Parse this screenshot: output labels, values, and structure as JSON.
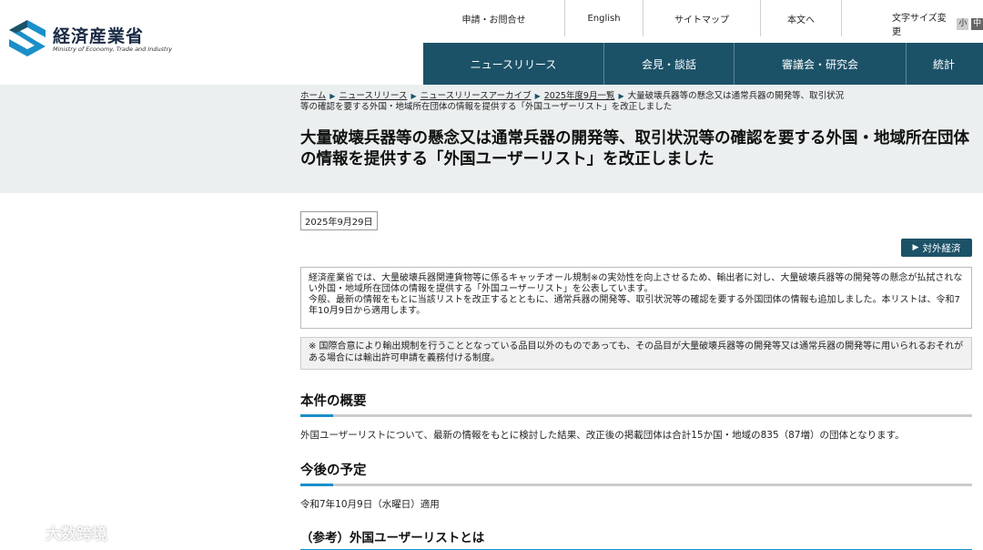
{
  "logo": {
    "name_ja": "経済産業省",
    "name_en": "Ministry of Economy, Trade and Industry"
  },
  "utility_nav": [
    "申請・お問合せ",
    "English",
    "サイトマップ",
    "本文へ"
  ],
  "font_size": {
    "label": "文字サイズ変更",
    "small": "小",
    "medium": "中"
  },
  "main_nav": [
    "ニュースリリース",
    "会見・談話",
    "審議会・研究会",
    "統計"
  ],
  "breadcrumb": {
    "items": [
      "ホーム",
      "ニュースリリース",
      "ニュースリリースアーカイブ",
      "2025年度9月一覧"
    ],
    "current": "大量破壊兵器等の懸念又は通常兵器の開発等、取引状況等の確認を要する外国・地域所在団体の情報を提供する「外国ユーザーリスト」を改正しました"
  },
  "page_title": "大量破壊兵器等の懸念又は通常兵器の開発等、取引状況等の確認を要する外国・地域所在団体の情報を提供する「外国ユーザーリスト」を改正しました",
  "date": "2025年9月29日",
  "tag": "対外経済",
  "lead": {
    "line1": "経済産業省では、大量破壊兵器関連貨物等に係るキャッチオール規制※の実効性を向上させるため、輸出者に対し、大量破壊兵器等の開発等の懸念が払拭されない外国・地域所在団体の情報を提供する「外国ユーザーリスト」を公表しています。",
    "line2": "今般、最新の情報をもとに当該リストを改正するとともに、通常兵器の開発等、取引状況等の確認を要する外国団体の情報も追加しました。本リストは、令和7年10月9日から適用します。"
  },
  "note": "※ 国際合意により輸出規制を行うこととなっている品目以外のものであっても、その品目が大量破壊兵器等の開発等又は通常兵器の開発等に用いられるおそれがある場合には輸出許可申請を義務付ける制度。",
  "sections": [
    {
      "heading": "本件の概要",
      "body": "外国ユーザーリストについて、最新の情報をもとに検討した結果、改正後の掲載団体は合計15か国・地域の835（87増）の団体となります。"
    },
    {
      "heading": "今後の予定",
      "body": "令和7年10月9日（水曜日）適用"
    },
    {
      "heading": "（参考）外国ユーザーリストとは"
    }
  ],
  "watermark": "大数跨境",
  "colors": {
    "nav_bg": "#1c5268",
    "band_bg": "#ebefef",
    "accent": "#1a8fc9"
  }
}
